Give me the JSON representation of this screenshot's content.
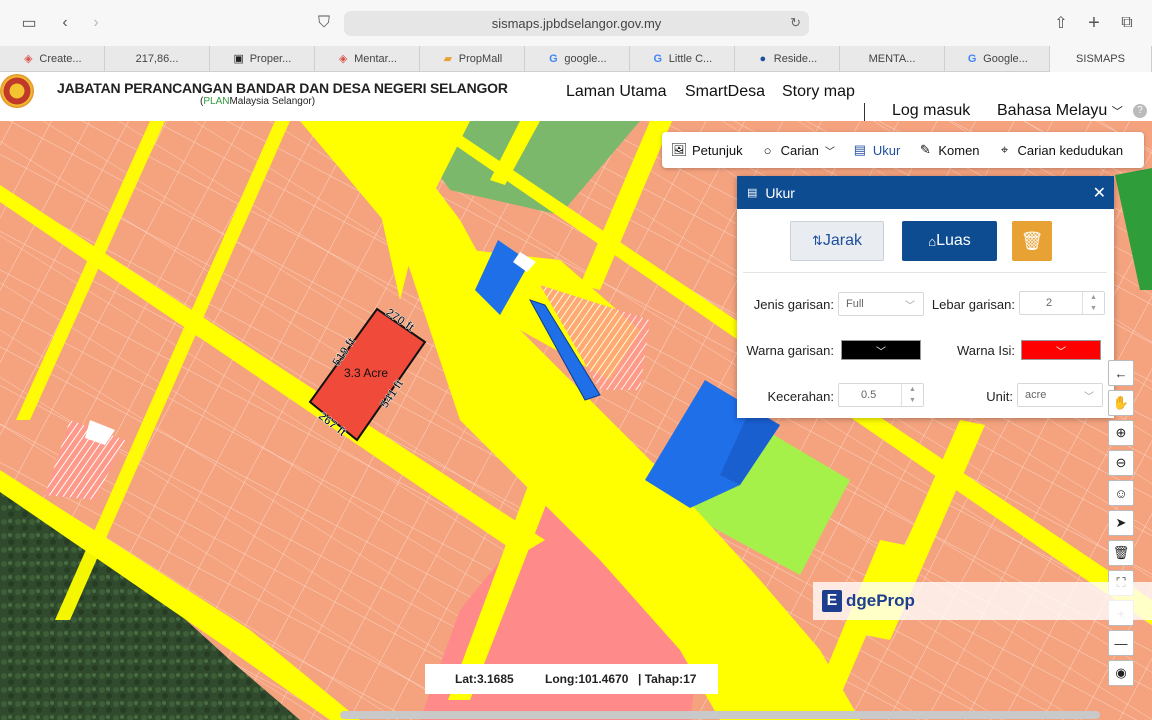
{
  "browser": {
    "url": "sismaps.jpbdselangor.gov.my",
    "tabs": [
      "Create...",
      "217,86...",
      "Proper...",
      "Mentar...",
      "PropMall",
      "google...",
      "Little C...",
      "Reside...",
      "MENTA...",
      "Google...",
      "SISMAPS"
    ]
  },
  "header": {
    "org_title": "JABATAN PERANCANGAN BANDAR DAN DESA NEGERI SELANGOR",
    "org_sub_plan": "PLAN",
    "org_sub_rest": "Malaysia Selangor)",
    "org_sub_open": "(",
    "nav": [
      "Laman Utama",
      "SmartDesa",
      "Story map"
    ],
    "login": "Log masuk",
    "language": "Bahasa Melayu"
  },
  "toolbar": {
    "items": [
      "Petunjuk",
      "Carian",
      "Ukur",
      "Komen",
      "Carian kedudukan"
    ],
    "active": "Ukur"
  },
  "ukur_panel": {
    "title": "Ukur",
    "btn_jarak": "Jarak",
    "btn_luas": "Luas",
    "jenis_label": "Jenis garisan:",
    "jenis_value": "Full",
    "lebar_label": "Lebar garisan:",
    "lebar_value": "2",
    "warna_label": "Warna garisan:",
    "warna_color": "#000000",
    "isi_label": "Warna Isi:",
    "isi_color": "#ff0000",
    "kecerahan_label": "Kecerahan:",
    "kecerahan_value": "0.5",
    "unit_label": "Unit:",
    "unit_value": "acre"
  },
  "measurement": {
    "area": "3.3 Acre",
    "top": "270 ft",
    "left": "519 ft",
    "right": "541 ft",
    "bottom": "267 ft"
  },
  "coords": {
    "lat": "Lat:3.1685",
    "long": "Long:101.4670",
    "tahap": "| Tahap:17"
  },
  "watermark": {
    "mark": "E",
    "text": "dgeProp"
  },
  "colors": {
    "residential": "#f5a37f",
    "road": "#ffff00",
    "institution": "#1e6fe8",
    "commercial": "#ff8a8a",
    "open_space": "#a6f04a",
    "agriculture": "#7bb86b",
    "accent": "#0e4c92",
    "trash": "#e8a234"
  }
}
